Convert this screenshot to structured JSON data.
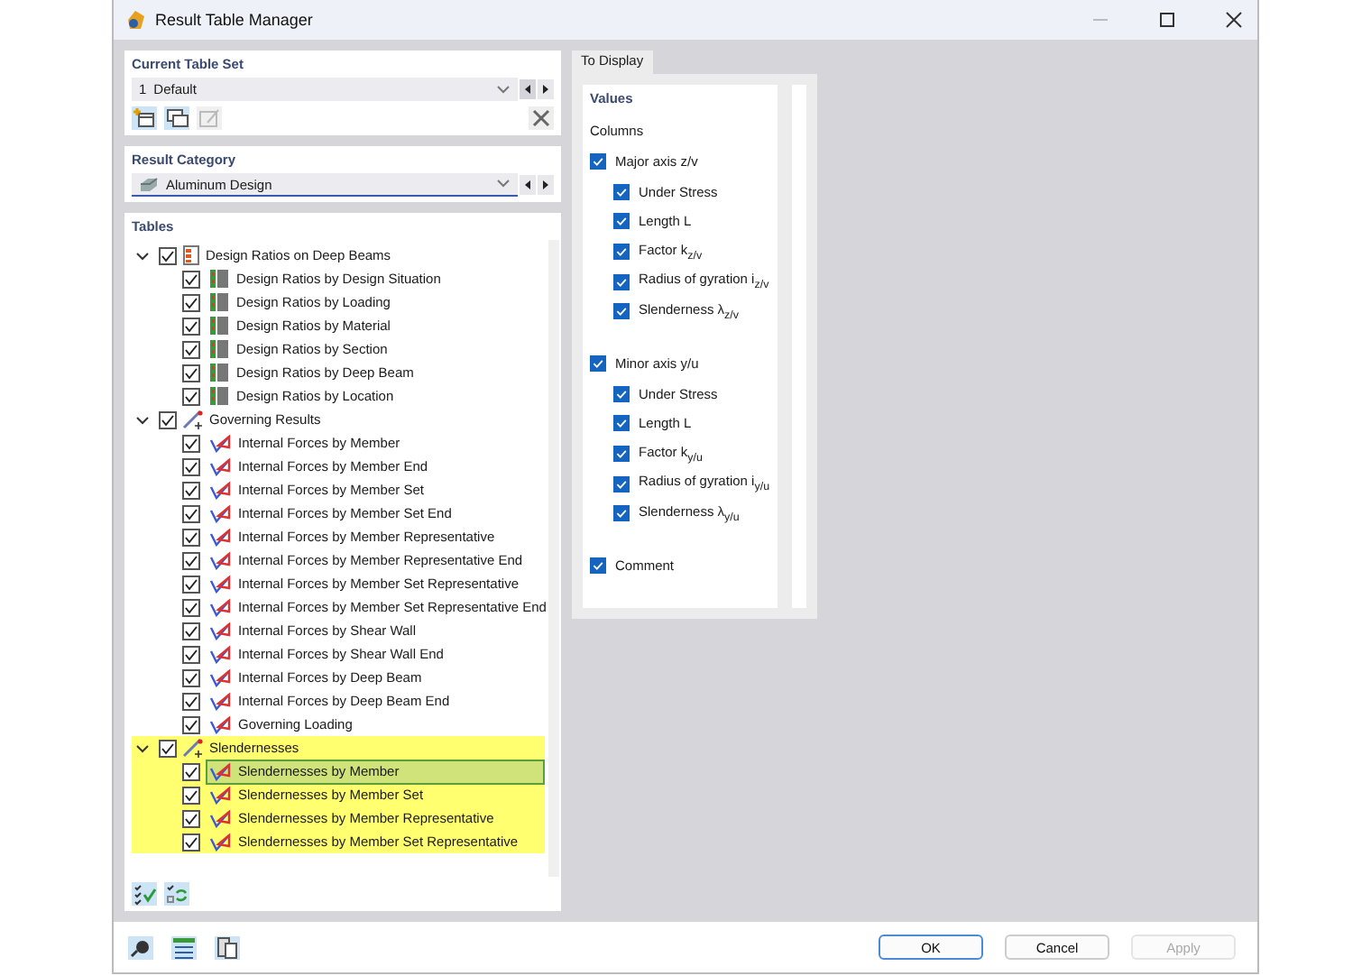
{
  "window": {
    "title": "Result Table Manager"
  },
  "current_table_set": {
    "title": "Current Table Set",
    "number": "1",
    "value": "Default"
  },
  "result_category": {
    "title": "Result Category",
    "value": "Aluminum Design"
  },
  "tables": {
    "title": "Tables",
    "groups": [
      {
        "label": "Design Ratios on Deep Beams",
        "kind": "ratios",
        "expanded": true,
        "checked": true,
        "highlighted": false,
        "children": [
          {
            "label": "Design Ratios by Design Situation",
            "checked": true,
            "selected": false
          },
          {
            "label": "Design Ratios by Loading",
            "checked": true,
            "selected": false
          },
          {
            "label": "Design Ratios by Material",
            "checked": true,
            "selected": false
          },
          {
            "label": "Design Ratios by Section",
            "checked": true,
            "selected": false
          },
          {
            "label": "Design Ratios by Deep Beam",
            "checked": true,
            "selected": false
          },
          {
            "label": "Design Ratios by Location",
            "checked": true,
            "selected": false
          }
        ]
      },
      {
        "label": "Governing Results",
        "kind": "forces",
        "expanded": true,
        "checked": true,
        "highlighted": false,
        "children": [
          {
            "label": "Internal Forces by Member",
            "checked": true,
            "selected": false
          },
          {
            "label": "Internal Forces by Member End",
            "checked": true,
            "selected": false
          },
          {
            "label": "Internal Forces by Member Set",
            "checked": true,
            "selected": false
          },
          {
            "label": "Internal Forces by Member Set End",
            "checked": true,
            "selected": false
          },
          {
            "label": "Internal Forces by Member Representative",
            "checked": true,
            "selected": false
          },
          {
            "label": "Internal Forces by Member Representative End",
            "checked": true,
            "selected": false
          },
          {
            "label": "Internal Forces by Member Set Representative",
            "checked": true,
            "selected": false
          },
          {
            "label": "Internal Forces by Member Set Representative End",
            "checked": true,
            "selected": false
          },
          {
            "label": "Internal Forces by Shear Wall",
            "checked": true,
            "selected": false
          },
          {
            "label": "Internal Forces by Shear Wall End",
            "checked": true,
            "selected": false
          },
          {
            "label": "Internal Forces by Deep Beam",
            "checked": true,
            "selected": false
          },
          {
            "label": "Internal Forces by Deep Beam End",
            "checked": true,
            "selected": false
          },
          {
            "label": "Governing Loading",
            "checked": true,
            "selected": false
          }
        ]
      },
      {
        "label": "Slendernesses",
        "kind": "forces",
        "expanded": true,
        "checked": true,
        "highlighted": true,
        "children": [
          {
            "label": "Slendernesses by Member",
            "checked": true,
            "selected": true
          },
          {
            "label": "Slendernesses by Member Set",
            "checked": true,
            "selected": false
          },
          {
            "label": "Slendernesses by Member Representative",
            "checked": true,
            "selected": false
          },
          {
            "label": "Slendernesses by Member Set Representative",
            "checked": true,
            "selected": false
          }
        ]
      }
    ]
  },
  "tabs": [
    {
      "label": "To Display",
      "selected": true
    }
  ],
  "values": {
    "title": "Values",
    "subtitle": "Columns",
    "items": [
      {
        "label": "Major axis z/v",
        "checked": true,
        "children": [
          {
            "label": "Under Stress",
            "checked": true
          },
          {
            "label": "Length L",
            "checked": true
          },
          {
            "label": "Factor k$_{z/v}$",
            "checked": true
          },
          {
            "label": "Radius of gyration i$_{z/v}$",
            "checked": true
          },
          {
            "label": "Slenderness λ$_{z/v}$",
            "checked": true
          }
        ]
      },
      {
        "label": "Minor axis y/u",
        "checked": true,
        "children": [
          {
            "label": "Under Stress",
            "checked": true
          },
          {
            "label": "Length L",
            "checked": true
          },
          {
            "label": "Factor k$_{y/u}$",
            "checked": true
          },
          {
            "label": "Radius of gyration i$_{y/u}$",
            "checked": true
          },
          {
            "label": "Slenderness λ$_{y/u}$",
            "checked": true
          }
        ]
      },
      {
        "label": "Comment",
        "checked": true
      }
    ]
  },
  "buttons": [
    {
      "label": "OK",
      "kind": "default"
    },
    {
      "label": "Cancel",
      "kind": "normal"
    },
    {
      "label": "Apply",
      "kind": "disabled"
    }
  ]
}
